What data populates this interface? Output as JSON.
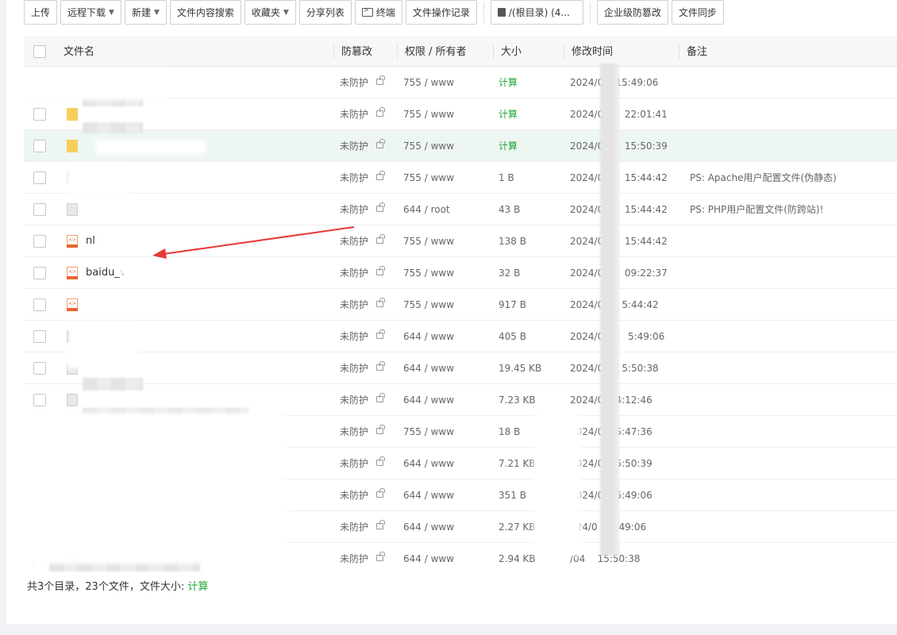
{
  "toolbar": {
    "upload": "上传",
    "remote_download": "远程下载",
    "new": "新建",
    "content_search": "文件内容搜索",
    "favorites": "收藏夹",
    "share_list": "分享列表",
    "terminal": "终端",
    "file_op_log": "文件操作记录",
    "path": "/(根目录) (4...",
    "enterprise_tamper": "企业级防篡改",
    "file_sync": "文件同步"
  },
  "columns": {
    "name": "文件名",
    "tamper": "防篡改",
    "perm": "权限 / 所有者",
    "size": "大小",
    "mtime": "修改时间",
    "note": "备注"
  },
  "rows": [
    {
      "icon": "folder-icon",
      "name": "",
      "tamper": "未防护",
      "perm": "755 / www",
      "size": "计算",
      "size_calc": true,
      "mtime": "2024/0    15:49:06",
      "note": ""
    },
    {
      "icon": "folder-icon",
      "name": "",
      "tamper": "未防护",
      "perm": "755 / www",
      "size": "计算",
      "size_calc": true,
      "mtime": "2024/05     22:01:41",
      "note": ""
    },
    {
      "icon": "folder-icon",
      "name": "",
      "tamper": "未防护",
      "perm": "755 / www",
      "size": "计算",
      "size_calc": true,
      "mtime": "2024/04,    15:50:39",
      "note": ""
    },
    {
      "icon": "file-icon",
      "name": "",
      "tamper": "未防护",
      "perm": "755 / www",
      "size": "1 B",
      "size_calc": false,
      "mtime": "2024/04,    15:44:42",
      "note": "PS: Apache用户配置文件(伪静态)"
    },
    {
      "icon": "file-icon",
      "name": "",
      "tamper": "未防护",
      "perm": "644 / root",
      "size": "43 B",
      "size_calc": false,
      "mtime": "2024/04     15:44:42",
      "note": "PS: PHP用户配置文件(防跨站)!"
    },
    {
      "icon": "html-file-icon",
      "name": "nl",
      "tamper": "未防护",
      "perm": "755 / www",
      "size": "138 B",
      "size_calc": false,
      "mtime": "2024/04     15:44:42",
      "note": ""
    },
    {
      "icon": "html-file-icon",
      "name": "baidu_v",
      "tamper": "未防护",
      "perm": "755 / www",
      "size": "32 B",
      "size_calc": false,
      "mtime": "2024/05     09:22:37",
      "note": ""
    },
    {
      "icon": "html-file-icon",
      "name": "",
      "tamper": "未防护",
      "perm": "755 / www",
      "size": "917 B",
      "size_calc": false,
      "mtime": "2024/04/   5:44:42",
      "note": ""
    },
    {
      "icon": "php-file-icon",
      "name": "",
      "tamper": "未防护",
      "perm": "644 / www",
      "size": "405 B",
      "size_calc": false,
      "mtime": "2024/04/0   5:49:06",
      "note": ""
    },
    {
      "icon": "file-icon",
      "name": "",
      "tamper": "未防护",
      "perm": "644 / www",
      "size": "19.45 KB",
      "size_calc": false,
      "mtime": "2024/04/   5:50:38",
      "note": ""
    },
    {
      "icon": "file-icon",
      "name": "",
      "tamper": "未防护",
      "perm": "644 / www",
      "size": "7.23 KB",
      "size_calc": false,
      "mtime": "2024/0    4:12:46",
      "note": ""
    },
    {
      "icon": "php-file-icon",
      "name": "",
      "tamper": "未防护",
      "perm": "755 / www",
      "size": "18 B",
      "size_calc": false,
      "mtime": "2024/0    5:47:36",
      "note": ""
    },
    {
      "icon": "php-file-icon",
      "name": "",
      "tamper": "未防护",
      "perm": "644 / www",
      "size": "7.21 KB",
      "size_calc": false,
      "mtime": "2024/0    5:50:39",
      "note": ""
    },
    {
      "icon": "php-file-icon",
      "name": "",
      "tamper": "未防护",
      "perm": "644 / www",
      "size": "351 B",
      "size_calc": false,
      "mtime": "2024/0    5:49:06",
      "note": ""
    },
    {
      "icon": "php-file-icon",
      "name": "",
      "tamper": "未防护",
      "perm": "644 / www",
      "size": "2.27 KB",
      "size_calc": false,
      "mtime": "024/0    5:49:06",
      "note": ""
    },
    {
      "icon": "php-file-icon",
      "name": "",
      "tamper": "未防护",
      "perm": "644 / www",
      "size": "2.94 KB",
      "size_calc": false,
      "mtime": "/04    15:50:38",
      "note": ""
    }
  ],
  "footer": {
    "summary": "共3个目录，23个文件，文件大小: ",
    "calc": "计算"
  },
  "colors": {
    "accent_green": "#20a53a",
    "highlight_row": "#eef6f2",
    "annotation_arrow": "#e53935"
  }
}
